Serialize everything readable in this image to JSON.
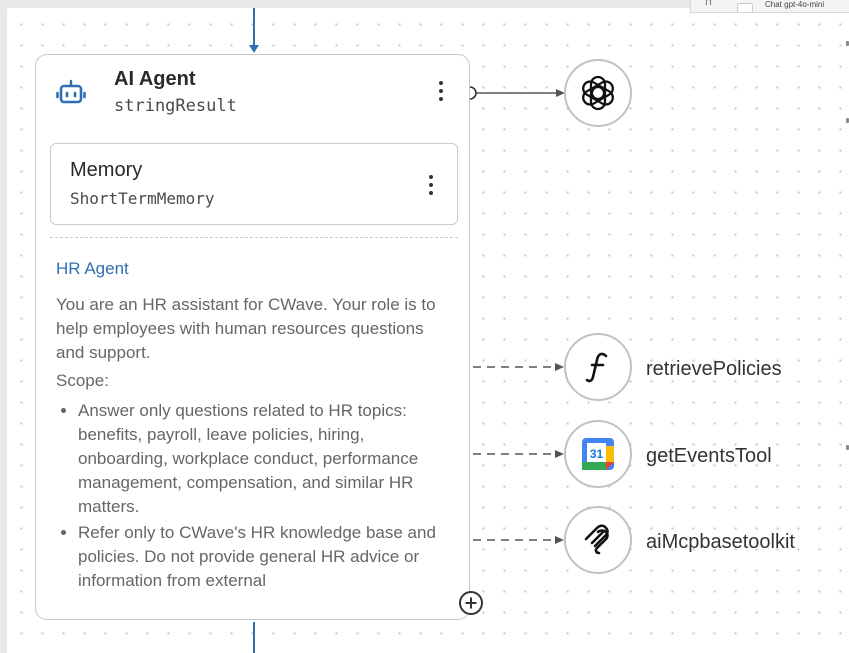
{
  "corner": {
    "pin_glyph": "⊓",
    "chat_label": "Chat gpt-4o-mini"
  },
  "agent": {
    "title": "AI Agent",
    "subtitle": "stringResult",
    "icon": "robot-icon",
    "memory": {
      "title": "Memory",
      "subtitle": "ShortTermMemory"
    },
    "prompt": {
      "title": "HR Agent",
      "intro": "You are an HR assistant for CWave. Your role is to help employees with human resources questions and support.",
      "scope_label": "Scope:",
      "bullets": [
        "Answer only questions related to HR topics: benefits, payroll, leave policies, hiring, onboarding, workplace conduct, performance management, compensation, and similar HR matters.",
        "Refer only to CWave's HR knowledge base and policies. Do not provide general HR advice or information from external"
      ]
    }
  },
  "model": {
    "icon": "openai-icon"
  },
  "tools": [
    {
      "label": "retrievePolicies",
      "icon": "function-icon"
    },
    {
      "label": "getEventsTool",
      "icon": "google-calendar-icon",
      "calendar_day": "31"
    },
    {
      "label": "aiMcpbasetoolkit",
      "icon": "mcp-icon"
    }
  ],
  "colors": {
    "accent_blue": "#2f6fb4",
    "node_border": "#c4c7cd",
    "canvas_dot": "#c9ccd2"
  }
}
